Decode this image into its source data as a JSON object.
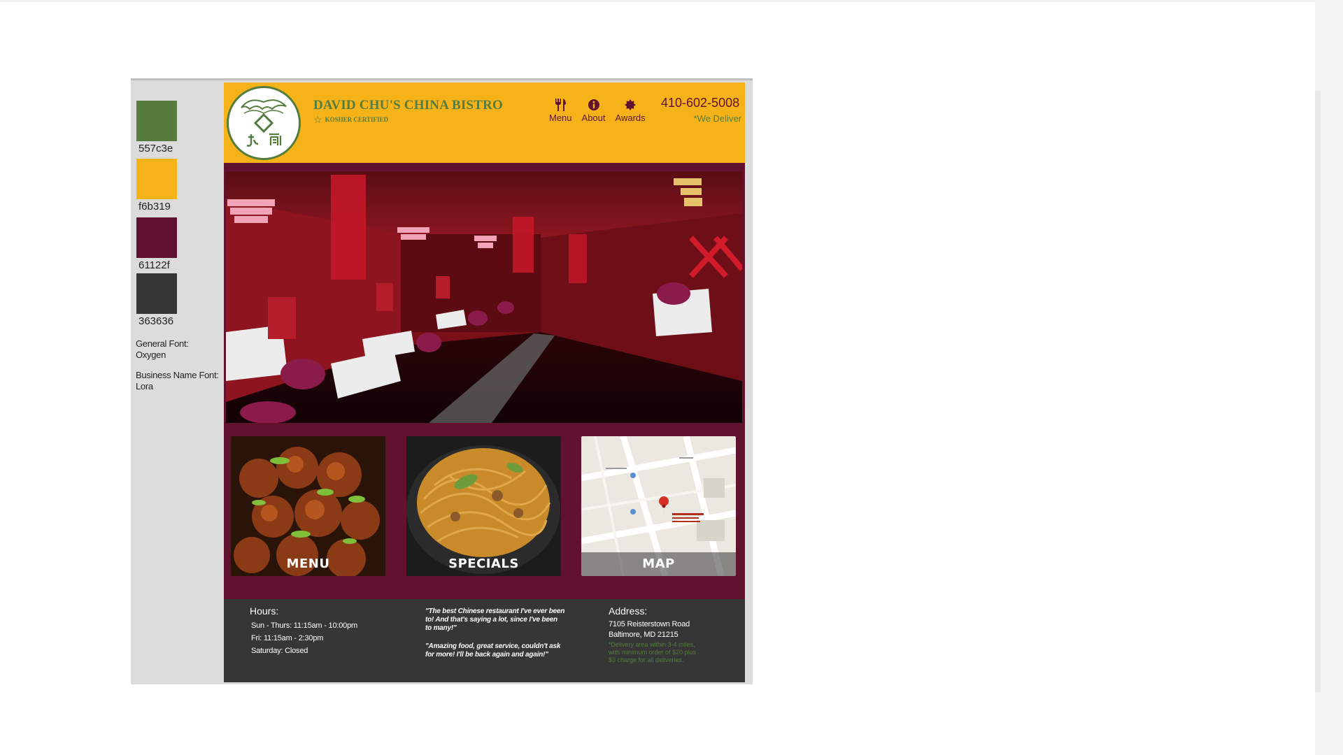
{
  "colors": {
    "green": "#557c3e",
    "orange": "#f6b319",
    "maroon": "#61122f",
    "charcoal": "#363636"
  },
  "style_guide": {
    "swatches": [
      {
        "hex": "#557c3e",
        "code": "557c3e"
      },
      {
        "hex": "#f6b319",
        "code": "f6b319"
      },
      {
        "hex": "#61122f",
        "code": "61122f"
      },
      {
        "hex": "#363636",
        "code": "363636"
      }
    ],
    "general_font_label": "General Font:",
    "general_font_value": "Oxygen",
    "business_font_label": "Business Name Font:",
    "business_font_value": "Lora"
  },
  "header": {
    "business_name": "DAVID CHU'S CHINA BISTRO",
    "badge_text": "KOSHER CERTIFIED",
    "nav": [
      {
        "label": "Menu",
        "icon": "utensils-icon"
      },
      {
        "label": "About",
        "icon": "info-icon"
      },
      {
        "label": "Awards",
        "icon": "award-icon"
      }
    ],
    "phone": "410-602-5008",
    "delivery_note": "*We Deliver"
  },
  "tiles": [
    {
      "label": "MENU"
    },
    {
      "label": "SPECIALS"
    },
    {
      "label": "MAP"
    }
  ],
  "footer": {
    "hours_title": "Hours:",
    "hours": [
      "Sun - Thurs:  11:15am - 10:00pm",
      "Fri:  11:15am - 2:30pm",
      "Saturday:  Closed"
    ],
    "quotes": [
      "\"The best Chinese restaurant I've ever been to! And that's saying a lot, since I've been to many!\"",
      "\"Amazing food, great service, couldn't ask for more! I'll be back again and again!\""
    ],
    "address_title": "Address:",
    "address_lines": [
      "7105 Reisterstown Road",
      "Baltimore, MD 21215"
    ],
    "delivery_details": "*Delivery area within 3-4 miles, with minimum order of $20 plus $3 charge for all deliveries."
  }
}
